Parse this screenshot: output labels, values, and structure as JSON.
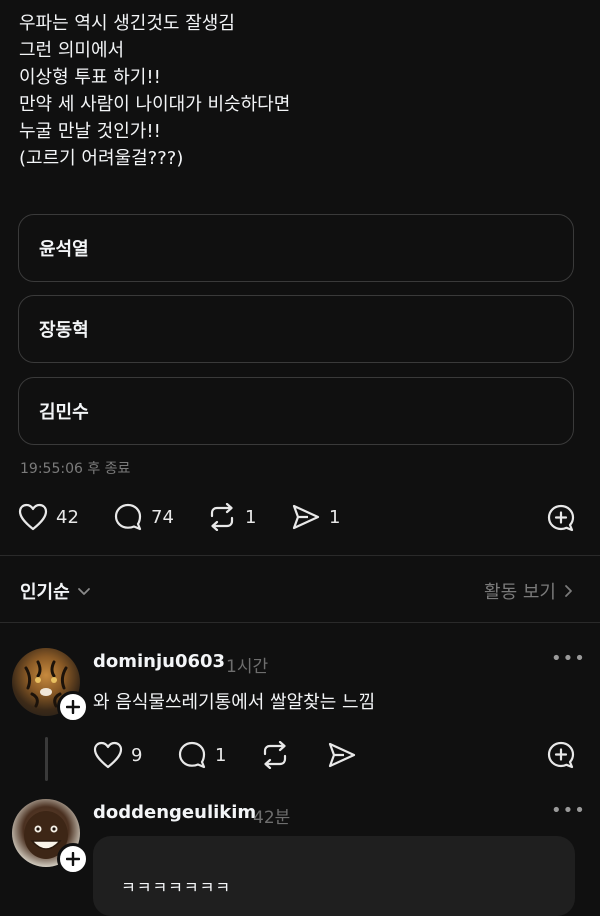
{
  "post": {
    "lines": [
      "우파는 역시 생긴것도 잘생김",
      "그런 의미에서",
      "이상형 투표 하기!!",
      "만약 세 사람이 나이대가 비슷하다면",
      "누굴 만날 것인가!!",
      "(고르기 어려울걸???)"
    ]
  },
  "poll": {
    "options": [
      "윤석열",
      "장동혁",
      "김민수"
    ],
    "end_text": "19:55:06 후 종료"
  },
  "actions": {
    "likes": "42",
    "comments": "74",
    "reposts": "1",
    "shares": "1"
  },
  "sort": {
    "label": "인기순",
    "activity_label": "활동 보기"
  },
  "comments": [
    {
      "username": "dominju0603",
      "time": "1시간",
      "text": "와 음식물쓰레기통에서 쌀알찾는 느낌",
      "likes": "9",
      "replies": "1"
    },
    {
      "username": "doddengeulikim",
      "time": "42분",
      "text": "ㅋㅋㅋㅋㅋㅋㅋ"
    }
  ],
  "icons": {
    "like": "heart-icon",
    "comment": "comment-bubble-icon",
    "repost": "repost-icon",
    "share": "send-icon",
    "quote": "add-quote-icon",
    "more": "more-options-icon"
  }
}
